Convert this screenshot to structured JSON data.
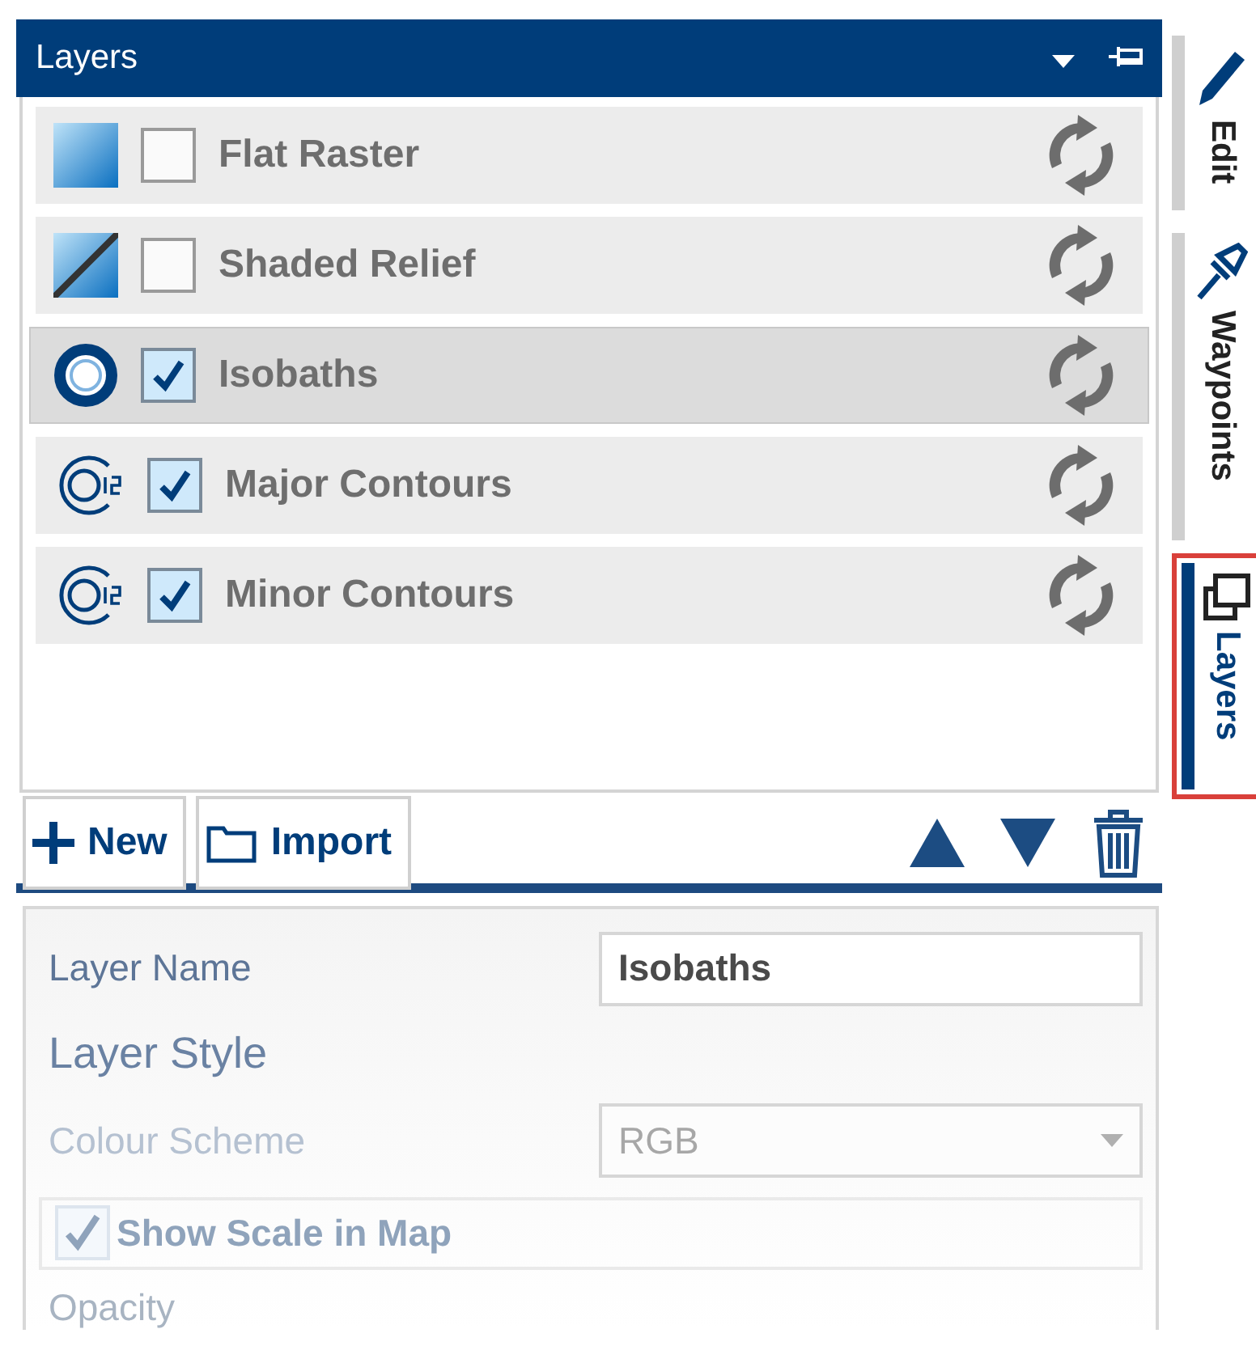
{
  "panel": {
    "title": "Layers"
  },
  "layers": [
    {
      "name": "Flat Raster",
      "kind": "raster",
      "visible": false,
      "selected": false
    },
    {
      "name": "Shaded Relief",
      "kind": "relief",
      "visible": false,
      "selected": false
    },
    {
      "name": "Isobaths",
      "kind": "isobath",
      "visible": true,
      "selected": true
    },
    {
      "name": "Major Contours",
      "kind": "contour",
      "visible": true,
      "selected": false
    },
    {
      "name": "Minor Contours",
      "kind": "contour",
      "visible": true,
      "selected": false
    }
  ],
  "toolbar": {
    "buttons": [
      {
        "label": "New",
        "kind": "new"
      },
      {
        "label": "Import",
        "kind": "import"
      }
    ]
  },
  "properties": {
    "layer_name": {
      "label": "Layer Name",
      "value": "Isobaths"
    },
    "section": "Layer Style",
    "colour_scheme": {
      "label": "Colour Scheme",
      "value": "RGB",
      "disabled": true
    },
    "show_scale": {
      "label": "Show Scale in Map",
      "checked": true,
      "disabled": true
    },
    "opacity": {
      "label": "Opacity"
    }
  },
  "side_tabs": [
    {
      "label": "Edit",
      "kind": "edit",
      "selected": false
    },
    {
      "label": "Waypoints",
      "kind": "waypoint",
      "selected": false
    },
    {
      "label": "Layers",
      "kind": "layers",
      "selected": true
    }
  ]
}
